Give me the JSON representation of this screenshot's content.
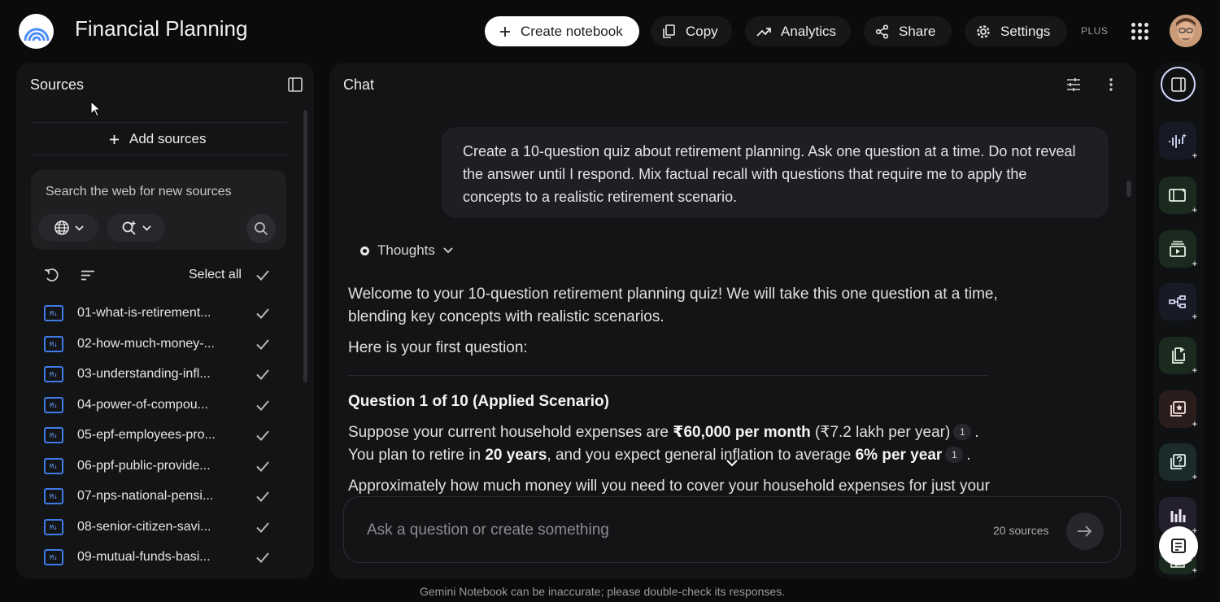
{
  "header": {
    "title": "Financial Planning",
    "create_label": "Create notebook",
    "copy_label": "Copy",
    "analytics_label": "Analytics",
    "share_label": "Share",
    "settings_label": "Settings",
    "plan_badge": "PLUS"
  },
  "sources": {
    "title": "Sources",
    "add_label": "Add sources",
    "search_placeholder": "Search the web for new sources",
    "select_all_label": "Select all",
    "items": [
      {
        "label": "01-what-is-retirement...",
        "checked": true
      },
      {
        "label": "02-how-much-money-...",
        "checked": true
      },
      {
        "label": "03-understanding-infl...",
        "checked": true
      },
      {
        "label": "04-power-of-compou...",
        "checked": true
      },
      {
        "label": "05-epf-employees-pro...",
        "checked": true
      },
      {
        "label": "06-ppf-public-provide...",
        "checked": true
      },
      {
        "label": "07-nps-national-pensi...",
        "checked": true
      },
      {
        "label": "08-senior-citizen-savi...",
        "checked": true
      },
      {
        "label": "09-mutual-funds-basi...",
        "checked": true
      }
    ]
  },
  "chat": {
    "title": "Chat",
    "user_message": "Create a 10-question quiz about retirement planning. Ask one question at a time. Do not reveal the answer until I respond. Mix factual recall with questions that require me to apply the concepts to a realistic retirement scenario.",
    "thoughts_label": "Thoughts",
    "response": {
      "intro": "Welcome to your 10-question retirement planning quiz! We will take this one question at a time, blending key concepts with realistic scenarios.",
      "lead": "Here is your first question:",
      "question_heading": "Question 1 of 10 (Applied Scenario)",
      "line1_a": "Suppose your current household expenses are ",
      "line1_b": "₹60,000 per month",
      "line1_c": " (₹7.2 lakh per year)",
      "line2_a": "You plan to retire in ",
      "line2_b": "20 years",
      "line2_c": ", and you expect general inflation to average ",
      "line2_d": "6% per year",
      "line3": "Approximately how much money will you need to cover your household expenses for just your",
      "citation": "1"
    },
    "composer_placeholder": "Ask a question or create something",
    "sources_count": "20 sources",
    "disclaimer": "Gemini Notebook can be inaccurate; please double-check its responses."
  },
  "studio_rail": {
    "items": [
      "audio-overview-icon",
      "video-overview-icon",
      "slides-icon",
      "mind-map-icon",
      "report-icon",
      "flashcards-icon",
      "quiz-icon",
      "infographic-icon"
    ]
  },
  "colors": {
    "background": "#0b0b0c",
    "panel": "#131416",
    "accent_blue": "#3f7be6",
    "studio_green": "#1b2a1f",
    "studio_red": "#2a1d1c"
  }
}
